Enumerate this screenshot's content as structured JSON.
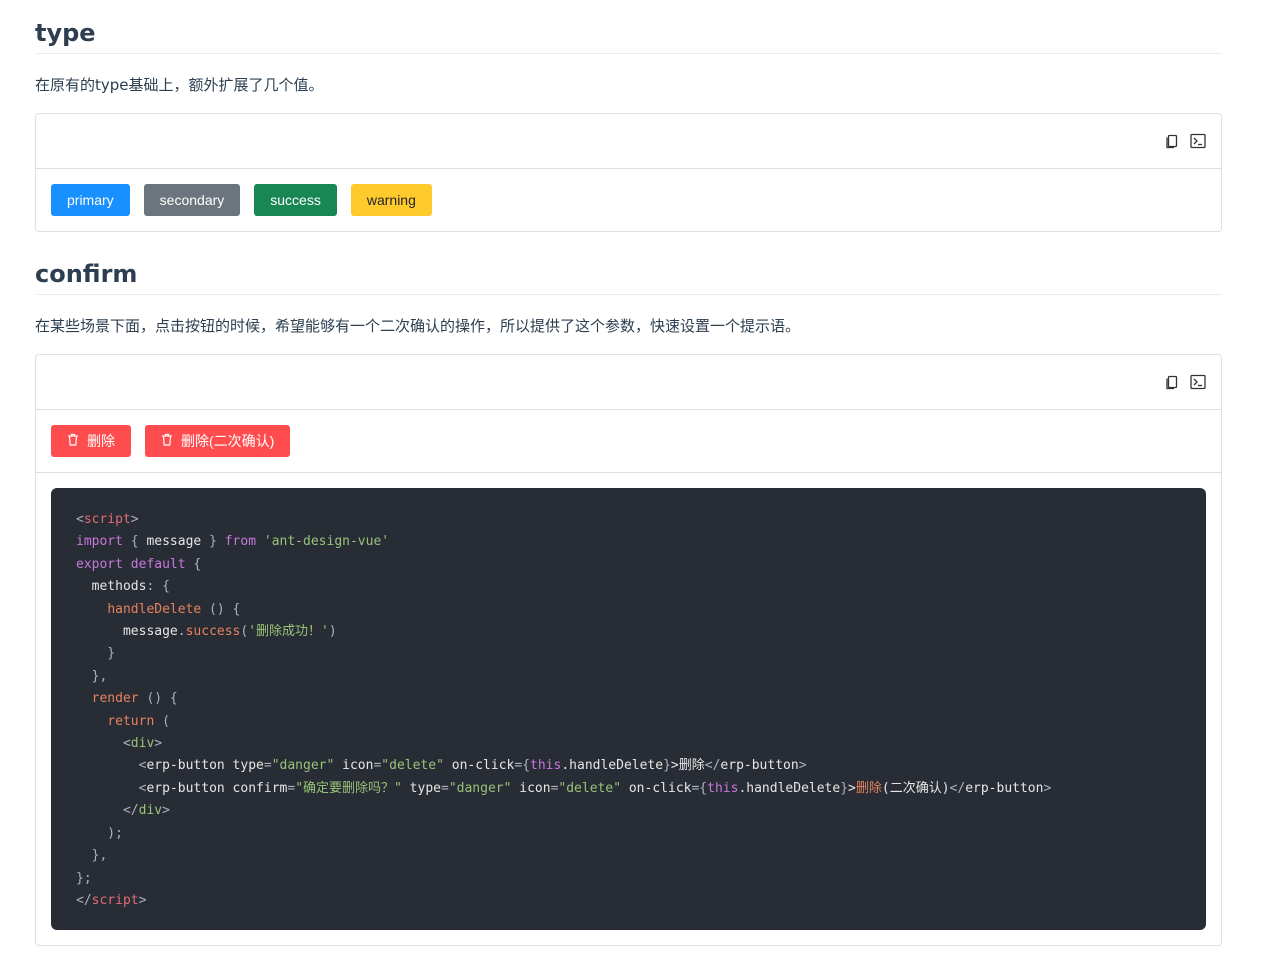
{
  "type_section": {
    "title": "type",
    "description": "在原有的type基础上，额外扩展了几个值。",
    "buttons": [
      {
        "label": "primary",
        "color": "#1890ff"
      },
      {
        "label": "secondary",
        "color": "#6c757d"
      },
      {
        "label": "success",
        "color": "#198754"
      },
      {
        "label": "warning",
        "color": "#ffca2c"
      }
    ]
  },
  "confirm_section": {
    "title": "confirm",
    "description": "在某些场景下面，点击按钮的时候，希望能够有一个二次确认的操作，所以提供了这个参数，快速设置一个提示语。",
    "buttons": [
      {
        "label": "删除",
        "icon": "trash-icon",
        "color": "#ff4d4f"
      },
      {
        "label": "删除(二次确认)",
        "icon": "trash-icon",
        "color": "#ff4d4f"
      }
    ],
    "code": {
      "l1_open": "<",
      "l1_tag": "script",
      "l1_close": ">",
      "l2_import": "import",
      "l2_open_brace": " { ",
      "l2_ident": "message",
      "l2_close_brace": " } ",
      "l2_from": "from",
      "l2_space": " ",
      "l2_module": "'ant-design-vue'",
      "l3_export": "export default",
      "l3_brace": " {",
      "l4_indent": "  ",
      "l4_key": "methods",
      "l4_rest": ": {",
      "l5_indent": "    ",
      "l5_fn": "handleDelete",
      "l5_rest": " () {",
      "l6_indent": "      ",
      "l6_obj": "message",
      "l6_dot": ".",
      "l6_method": "success",
      "l6_paren": "(",
      "l6_str": "'删除成功！'",
      "l6_close": ")",
      "l7": "    }",
      "l8": "  },",
      "l9_indent": "  ",
      "l9_fn": "render",
      "l9_rest": " () {",
      "l10_indent": "    ",
      "l10_kw": "return",
      "l10_rest": " (",
      "l11_indent": "      <",
      "l11_tag": "div",
      "l11_close": ">",
      "l12_indent": "        <",
      "l12_tag": "erp-button",
      "l12_attr1": " type",
      "l12_eq1": "=",
      "l12_val1": "\"danger\"",
      "l12_attr2": " icon",
      "l12_eq2": "=",
      "l12_val2": "\"delete\"",
      "l12_attr3": " on-click",
      "l12_eq3": "={",
      "l12_this": "this",
      "l12_handler": ".handleDelete",
      "l12_brace_close": "}",
      "l12_gt": ">",
      "l12_text": "删除",
      "l12_end_open": "</",
      "l12_end_tag": "erp-button",
      "l12_end_gt": ">",
      "l13_indent": "        <",
      "l13_tag": "erp-button",
      "l13_attr0": " confirm",
      "l13_eq0": "=",
      "l13_val0": "\"确定要删除吗？\"",
      "l13_attr1": " type",
      "l13_eq1": "=",
      "l13_val1": "\"danger\"",
      "l13_attr2": " icon",
      "l13_eq2": "=",
      "l13_val2": "\"delete\"",
      "l13_attr3": " on-click",
      "l13_eq3": "={",
      "l13_this": "this",
      "l13_handler": ".handleDelete",
      "l13_brace_close": "}",
      "l13_gt": ">",
      "l13_text1": "删除",
      "l13_text2": "(二次确认)",
      "l13_end_open": "</",
      "l13_end_tag": "erp-button",
      "l13_end_gt": ">",
      "l14_indent": "      </",
      "l14_tag": "div",
      "l14_close": ">",
      "l15": "    );",
      "l16": "  },",
      "l17": "};",
      "l18_open": "</",
      "l18_tag": "script",
      "l18_close": ">"
    }
  },
  "toolbar": {
    "copy_icon": "copy-icon",
    "code_icon": "terminal-icon"
  },
  "colors": {
    "code_bg": "#282c34",
    "heading": "#2c3e50",
    "border": "#dcdfe6"
  }
}
